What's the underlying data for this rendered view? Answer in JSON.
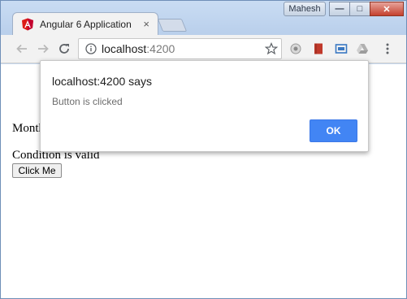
{
  "window": {
    "user_badge": "Mahesh",
    "controls": {
      "minimize": "—",
      "maximize": "□",
      "close": "✕"
    }
  },
  "tab": {
    "title": "Angular 6 Application",
    "close_glyph": "×",
    "favicon": "angular-icon",
    "favicon_color": "#dd1b16"
  },
  "toolbar": {
    "back_icon": "back-arrow-icon",
    "forward_icon": "forward-arrow-icon",
    "reload_icon": "reload-icon",
    "address": {
      "host": "localhost",
      "port": ":4200"
    },
    "info_icon": "info-icon",
    "bookmark_icon": "star-icon",
    "extensions": [
      "extension-circle-icon",
      "extension-book-icon",
      "extension-cast-icon",
      "extension-drive-icon"
    ],
    "menu_icon": "kebab-menu-icon"
  },
  "page": {
    "months_text": "Months",
    "condition_text": "Condition is valid",
    "button_label": "Click Me"
  },
  "alert": {
    "title": "localhost:4200 says",
    "message": "Button is clicked",
    "ok_label": "OK",
    "ok_color": "#4285f4"
  }
}
